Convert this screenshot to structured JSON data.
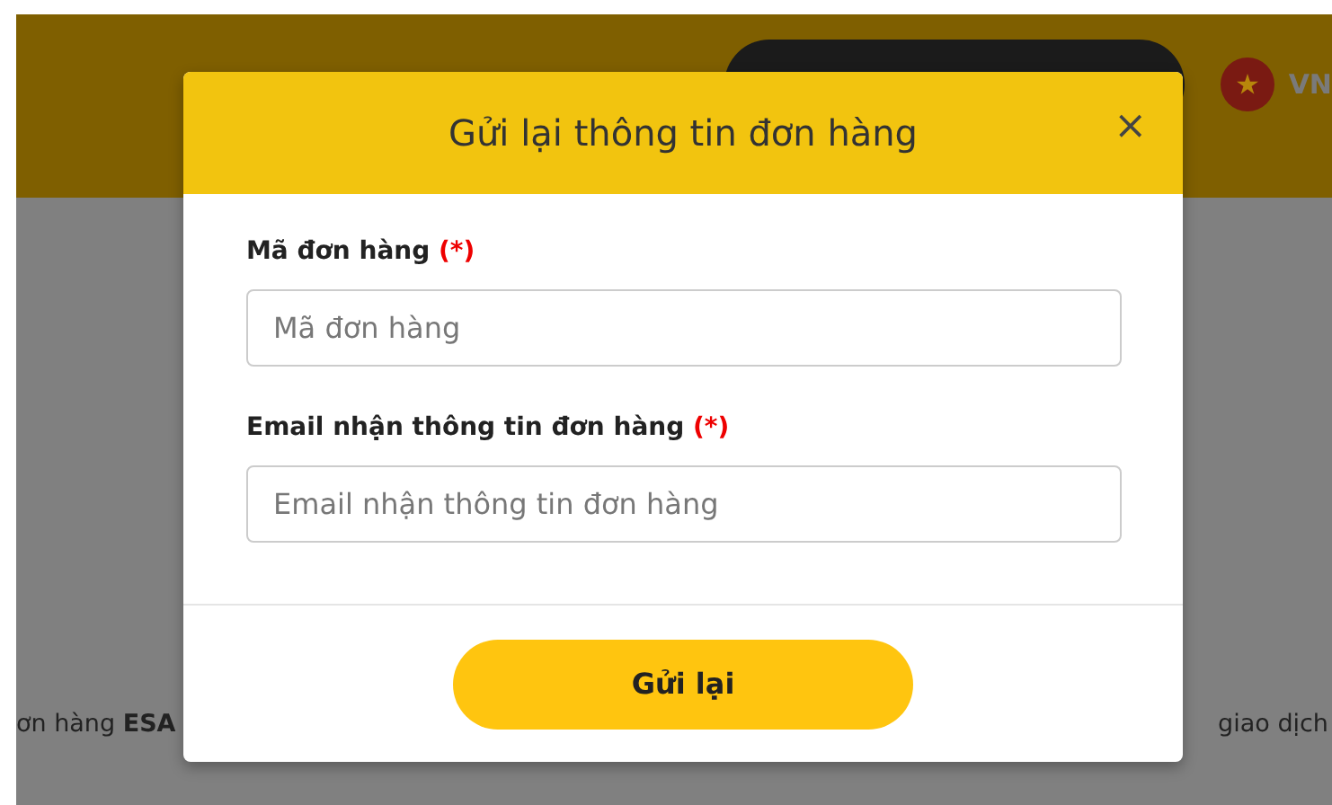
{
  "page": {
    "language": "VN",
    "line_start": "ơn hàng **ESA**",
    "line_end": "giao dịch"
  },
  "modal": {
    "title": "Gửi lại thông tin đơn hàng",
    "close": "×",
    "fields": [
      {
        "label": "Mã đơn hàng",
        "required_mark": "(*)",
        "placeholder": "Mã đơn hàng"
      },
      {
        "label": "Email nhận thông tin đơn hàng",
        "required_mark": "(*)",
        "placeholder": "Email nhận thông tin đơn hàng"
      }
    ],
    "submit": "Gửi lại"
  }
}
